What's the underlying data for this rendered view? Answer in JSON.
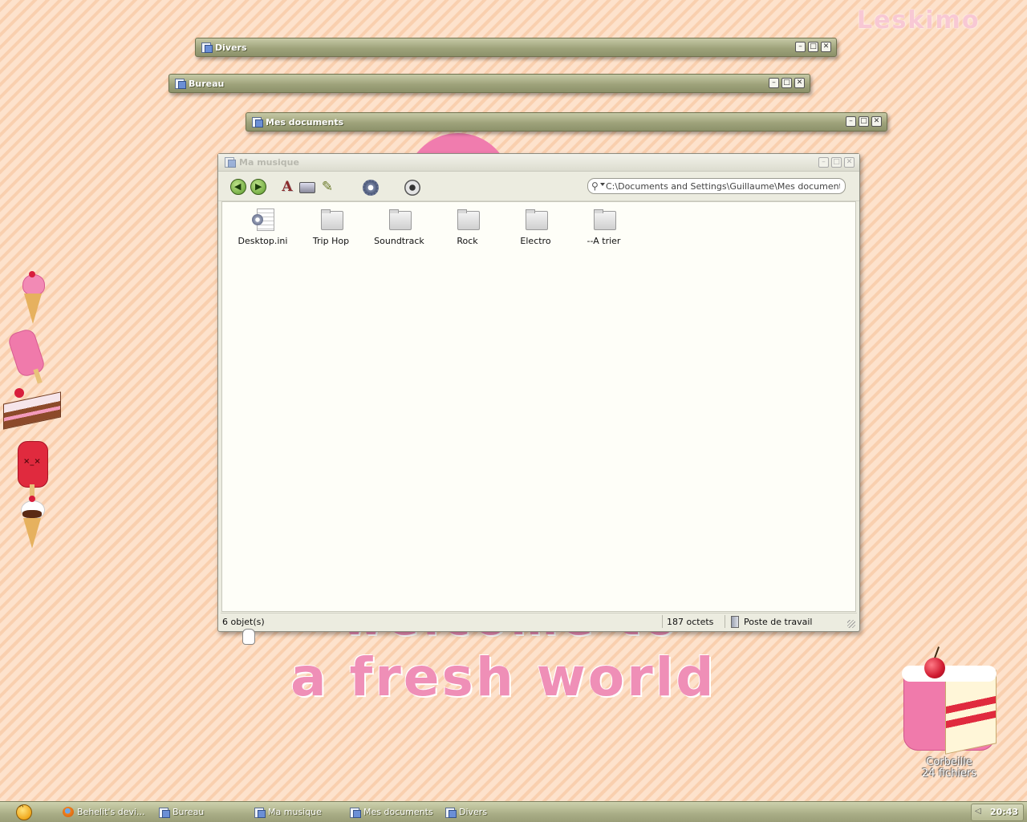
{
  "desktop": {
    "brand": "Leskimo",
    "wallpaper_text": "a fresh world",
    "wallpaper_partial_text": "welcome to"
  },
  "collapsed_windows": [
    {
      "title": "Divers",
      "icon": "folder-icon"
    },
    {
      "title": "Bureau",
      "icon": "folder-icon"
    },
    {
      "title": "Mes documents",
      "icon": "folder-icon"
    }
  ],
  "window": {
    "title": "Ma musique",
    "buttons": {
      "minimize": "–",
      "maximize": "□",
      "close": "✕"
    },
    "toolbar": {
      "back_icon": "back-arrow-icon",
      "forward_icon": "forward-arrow-icon",
      "up_icon": "up-folder-icon",
      "drive_icon": "drive-icon",
      "edit_icon": "pen-icon",
      "settings_icon": "gear-icon",
      "view_icon": "eye-icon",
      "address_value": "C:\\Documents and Settings\\Guillaume\\Mes documents\\Ma mu"
    },
    "items": [
      {
        "label": "Desktop.ini",
        "type": "file"
      },
      {
        "label": "Trip Hop",
        "type": "folder"
      },
      {
        "label": "Soundtrack",
        "type": "folder"
      },
      {
        "label": "Rock",
        "type": "folder"
      },
      {
        "label": "Electro",
        "type": "folder"
      },
      {
        "label": "--A trier",
        "type": "folder"
      }
    ],
    "status": {
      "count": "6 objet(s)",
      "size": "187 octets",
      "zone": "Poste de travail"
    }
  },
  "dock": {
    "items": [
      "ice-cream-cone-icon",
      "popsicle-icon",
      "cake-slice-icon",
      "red-popsicle-icon",
      "sundae-cone-icon"
    ]
  },
  "recycle_bin": {
    "label": "Corbeille",
    "count": "24 fichiers"
  },
  "taskbar": {
    "tasks": [
      {
        "label": "Behelit's devi...",
        "icon": "firefox-icon"
      },
      {
        "label": "Bureau",
        "icon": "folder-icon"
      },
      {
        "label": "Ma musique",
        "icon": "folder-icon"
      },
      {
        "label": "Mes documents",
        "icon": "folder-icon"
      },
      {
        "label": "Divers",
        "icon": "folder-icon"
      }
    ],
    "clock": "20:43"
  }
}
